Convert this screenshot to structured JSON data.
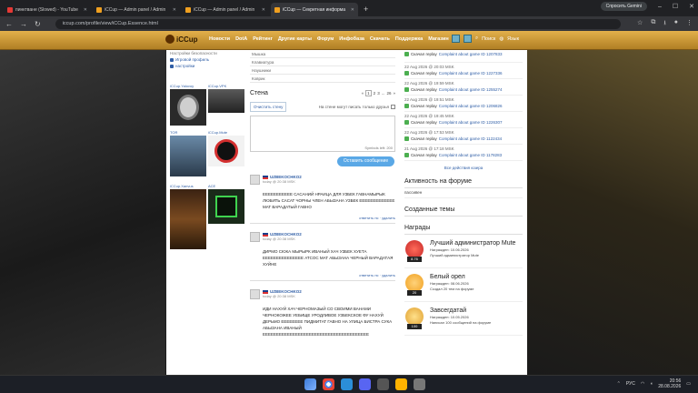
{
  "browser": {
    "tabs": [
      {
        "title": "пинктване (Slowed) - YouTube",
        "color": "#e53935",
        "active": false
      },
      {
        "title": "iCCup — Admin panel / Admin",
        "color": "#f0a020",
        "active": false
      },
      {
        "title": "iCCup — Admin panel / Admin",
        "color": "#f0a020",
        "active": false
      },
      {
        "title": "iCCup — Секретная информа",
        "color": "#f0a020",
        "active": true
      }
    ],
    "new_tab": "+",
    "gemini": "Спросить Gemini",
    "url": "iccup.com/profile/view/iCCup.Essence.html",
    "controls": {
      "back": "←",
      "forward": "→",
      "reload": "↻",
      "min": "–",
      "max": "☐",
      "close": "✕"
    }
  },
  "site": {
    "logo": "iCCup",
    "nav": [
      "Новости",
      "DotA",
      "Рейтинг",
      "Другие карты",
      "Форум",
      "Инфобаза",
      "Скачать",
      "Поддержка",
      "Магазин"
    ],
    "search": "Поиск",
    "lang": "Язык"
  },
  "left": {
    "menu": [
      {
        "label": "Настройки безопасности",
        "link": false
      },
      {
        "label": "Игровой профиль",
        "link": true
      },
      {
        "label": "настройки",
        "link": true
      }
    ],
    "friends": [
      {
        "name": "iCCup.Yalovoy",
        "bg": "#2a2a2a"
      },
      {
        "name": "iCCup.VPK",
        "bg": "#3a3a3a"
      },
      {
        "name": "TOR",
        "bg": "#3b4a5a"
      },
      {
        "name": "iCCup.Mute",
        "bg": "#f2f2f2"
      },
      {
        "name": "iCCup.Xanvus",
        "bg": "#4a2e1a"
      },
      {
        "name": "ACE",
        "bg": "#1a2a1a"
      }
    ]
  },
  "middle": {
    "rows": [
      "Мышка",
      "Клавиатура",
      "Наушники",
      "Коврик"
    ],
    "wall_title": "Стена",
    "pages": [
      "«",
      "1",
      "2",
      "3",
      "...",
      "26",
      "»"
    ],
    "clear_wall": "Очистить стену",
    "only_friends": "На стене могут писать только друзья",
    "counter": "Symbols left: 200",
    "send": "Оставить сообщение",
    "posts": [
      {
        "author": "UZBEKOCHKO2",
        "time": "today @ 20:38 MSK",
        "text": "ЕЕЕЕЕЕЕЕЕЕЕ САСАНИЙ НРАИЦА ДЛЯ УЗБЕК ГАВНАМЫРЫК ЛЮБИТЬ САСАТ ЧОРНЫ ЧЛЕН АБЫЗАНА УЗБЕК ЕЕЕЕЕЕЕЕЕЕЕЕЕ МАТ ВАРАДАТЫЙ ГАВНО",
        "actions": "ответить нс · удалить"
      },
      {
        "author": "UZBEKOCHKO2",
        "time": "today @ 20:38 MSK",
        "text": "ДИРМО СЮКА МЫРЫРК ИВАНЫЙ ХАЧ УЗБЕК ХУЕТА ЕЕЕЕЕЕЕЕЕЕЕЕЕЕЕ АТСОС МАТ АБЫЗАНА ЧЕРНЫЙ ВАРАДАТАЯ ХУЙНЕ",
        "actions": "ответить нс · удалить"
      },
      {
        "author": "UZBEKOCHKO2",
        "time": "today @ 20:38 MSK",
        "text": "ИДИ НАХУЙ ХАЧ ЧЕРНОМАЗЫЙ СО СВОИМИ ВАНАМИ ЧЕРНОКОЖЕЕ УЕБИЩЕ УРОДЛИВОЕ УЗБЕКСКОЕ ФУ НАХУЙ ДЕРЬМО ЕЕЕЕЕЕЕЕ ПИДМИТАТ ГАВНО НА УЛИЦА БИСТРА СУКА АБЫЗАНА ИВАНЫЙ ЕЕЕЕЕЕЕЕЕЕЕЕЕЕЕЕЕЕЕЕЕЕЕЕЕЕЕЕЕЕЕЕЕЕЕЕЕЕЕ",
        "actions": "ответить нс · удалить"
      }
    ]
  },
  "right": {
    "replays": [
      {
        "date": "22 Aug 2026 @ 20:09 MSK",
        "action": "Скачал replay",
        "link": "Complaint about game ID 1207833"
      },
      {
        "date": "22 Aug 2026 @ 20:03 MSK",
        "action": "Скачал replay",
        "link": "Complaint about game ID 1227336"
      },
      {
        "date": "22 Aug 2026 @ 19:59 MSK",
        "action": "Скачал replay",
        "link": "Complaint about game ID 1255274"
      },
      {
        "date": "22 Aug 2026 @ 19:51 MSK",
        "action": "Скачал replay",
        "link": "Complaint about game ID 1206826"
      },
      {
        "date": "22 Aug 2026 @ 19:45 MSK",
        "action": "Скачал replay",
        "link": "Complaint about game ID 1226307"
      },
      {
        "date": "22 Aug 2026 @ 17:53 MSK",
        "action": "Скачал replay",
        "link": "Complaint about game ID 1122434"
      },
      {
        "date": "21 Aug 2026 @ 17:18 MSK",
        "action": "Скачал replay",
        "link": "Complaint about game ID 1178283"
      }
    ],
    "all_actions": "Все действия юзера",
    "forum_activity": "Активность на форуме",
    "forum_sub": "пассивен",
    "created_topics": "Созданные темы",
    "awards_title": "Награды",
    "awards": [
      {
        "title": "Лучший администратор Mute",
        "awarded": "Награжден: 10.06.2026",
        "desc": "Лучший администратор Mute",
        "badge": "8.76",
        "color": "#c62828"
      },
      {
        "title": "Белый орел",
        "awarded": "Награжден: 08.06.2026",
        "desc": "Создал 20 тем на форуме",
        "badge": "20",
        "color": "#f0a020"
      },
      {
        "title": "Завсегдатай",
        "awarded": "Награжден: 10.05.2026",
        "desc": "Написал 100 сообщений на форуме",
        "badge": "100",
        "color": "#e0a030"
      }
    ]
  },
  "taskbar": {
    "lang": "РУС",
    "time": "20:56",
    "date": "28.08.2026",
    "apps": [
      "#3c7bd8",
      "#4285f4",
      "#2b8ed8",
      "#5865f2",
      "#555",
      "#ffb300",
      "#777"
    ]
  }
}
